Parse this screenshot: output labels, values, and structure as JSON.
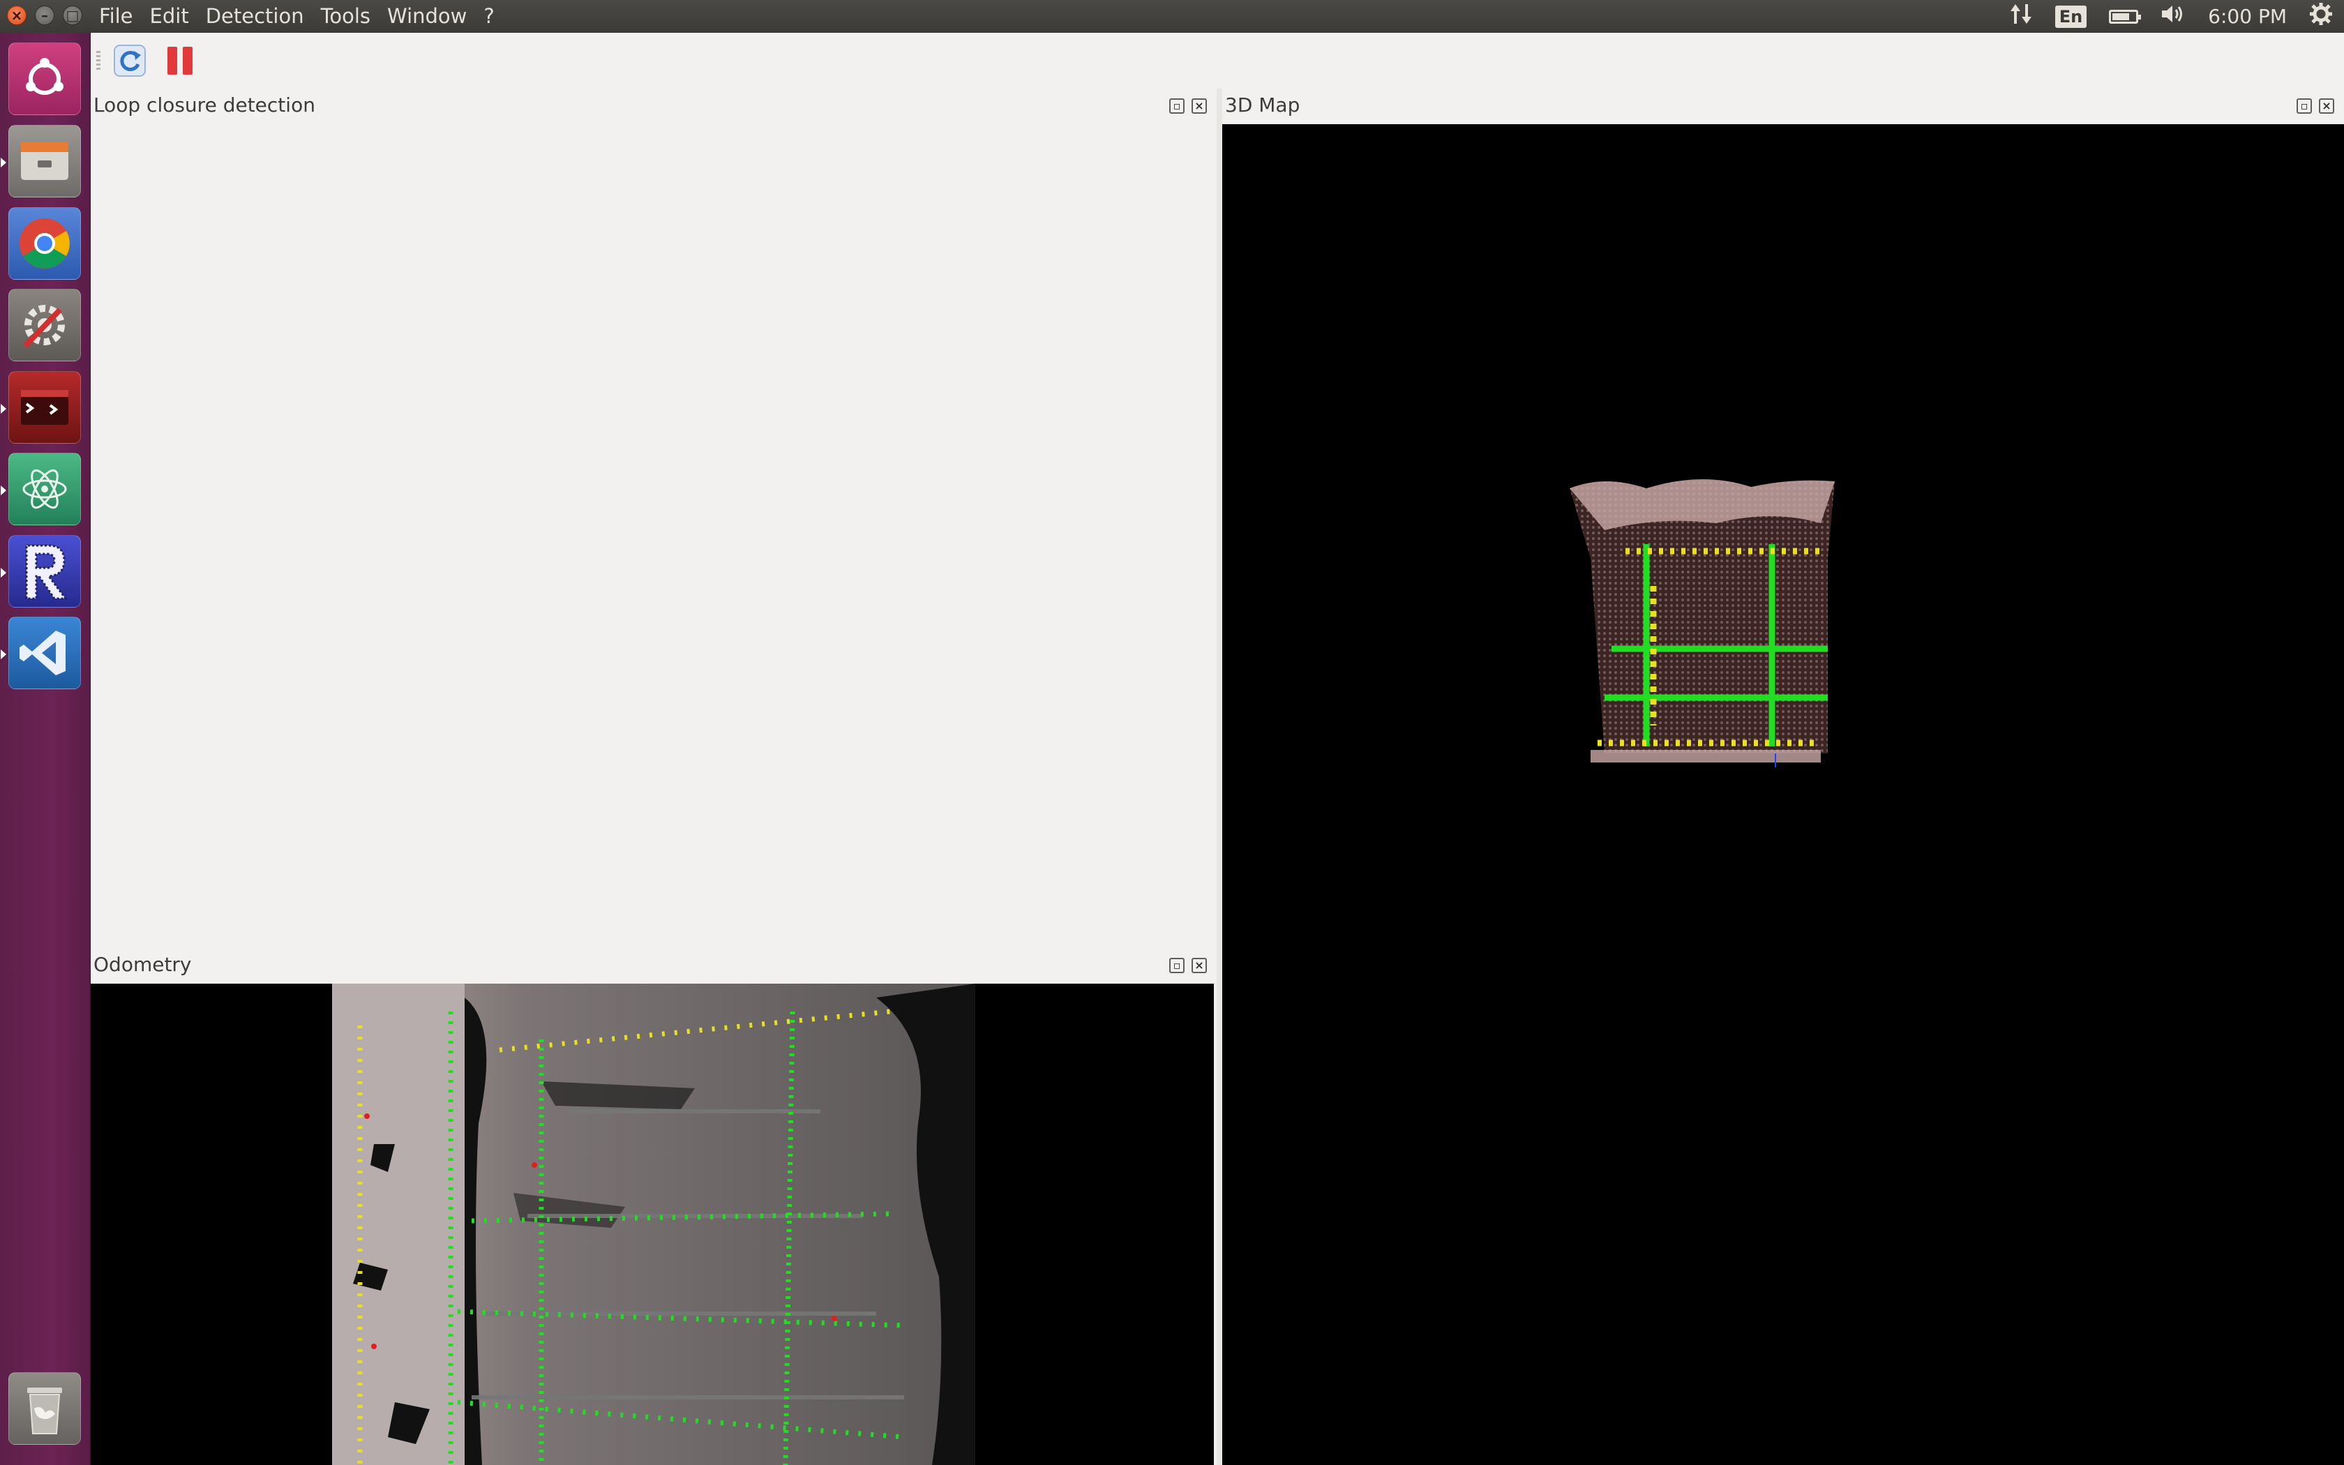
{
  "window": {
    "close_glyph": "×",
    "min_glyph": "–",
    "max_glyph": "□"
  },
  "menu": {
    "items": [
      {
        "label": "File"
      },
      {
        "label": "Edit"
      },
      {
        "label": "Detection"
      },
      {
        "label": "Tools"
      },
      {
        "label": "Window"
      },
      {
        "label": "?"
      }
    ]
  },
  "indicators": {
    "network_icon": "network-transfer-icon",
    "language": "En",
    "battery_level": 0.75,
    "volume_icon": "volume-icon",
    "clock": "6:00 PM",
    "settings_icon": "gear-icon"
  },
  "launcher": {
    "items": [
      {
        "name": "ubuntu-dash-icon",
        "color": "#b72d6f"
      },
      {
        "name": "files-icon",
        "color": "#8d8a86"
      },
      {
        "name": "chrome-icon",
        "color": "#3d6fd0"
      },
      {
        "name": "system-settings-icon",
        "color": "#6f6b68"
      },
      {
        "name": "terminal-icon",
        "color": "#8b1c1c"
      },
      {
        "name": "atom-icon",
        "color": "#3aa373"
      },
      {
        "name": "rtabmap-icon",
        "color": "#3a3fb5"
      },
      {
        "name": "vscode-icon",
        "color": "#2c6fb8"
      },
      {
        "name": "trash-icon",
        "color": "#8d8a86"
      }
    ]
  },
  "toolbar": {
    "refresh_icon": "refresh-icon",
    "pause_icon": "pause-icon"
  },
  "panels": {
    "loop_closure": {
      "title": "Loop closure detection"
    },
    "map3d": {
      "title": "3D Map"
    },
    "odometry": {
      "title": "Odometry"
    }
  },
  "colors": {
    "feature_green": "#22dd22",
    "feature_yellow": "#e8e020",
    "feature_red": "#e02020",
    "launcher_bg": "#6c2355",
    "topbar_bg": "#3f3e3a"
  }
}
